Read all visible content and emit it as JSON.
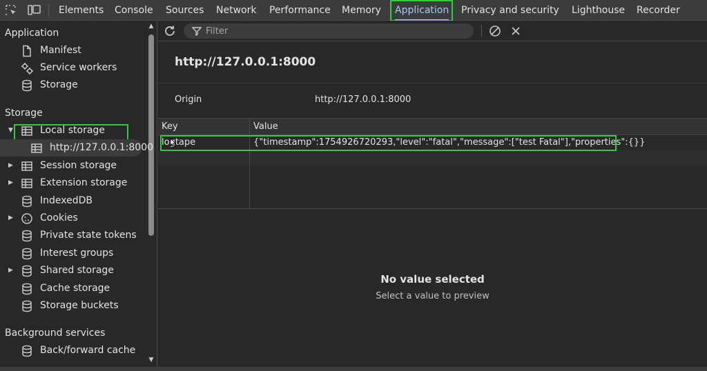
{
  "tabs": [
    {
      "label": "Elements"
    },
    {
      "label": "Console"
    },
    {
      "label": "Sources"
    },
    {
      "label": "Network"
    },
    {
      "label": "Performance"
    },
    {
      "label": "Memory"
    },
    {
      "label": "Application",
      "active": true
    },
    {
      "label": "Privacy and security"
    },
    {
      "label": "Lighthouse"
    },
    {
      "label": "Recorder"
    }
  ],
  "sidebar": {
    "application": {
      "title": "Application",
      "items": [
        {
          "label": "Manifest",
          "icon": "document-icon"
        },
        {
          "label": "Service workers",
          "icon": "gears-icon"
        },
        {
          "label": "Storage",
          "icon": "database-icon"
        }
      ]
    },
    "storage": {
      "title": "Storage",
      "items": [
        {
          "label": "Local storage",
          "icon": "table-icon",
          "expanded": true
        },
        {
          "label": "http://127.0.0.1:8000",
          "icon": "table-icon",
          "selected": true
        },
        {
          "label": "Session storage",
          "icon": "table-icon"
        },
        {
          "label": "Extension storage",
          "icon": "table-icon"
        },
        {
          "label": "IndexedDB",
          "icon": "database-icon"
        },
        {
          "label": "Cookies",
          "icon": "cookie-icon"
        },
        {
          "label": "Private state tokens",
          "icon": "database-icon"
        },
        {
          "label": "Interest groups",
          "icon": "database-icon"
        },
        {
          "label": "Shared storage",
          "icon": "database-icon"
        },
        {
          "label": "Cache storage",
          "icon": "database-icon"
        },
        {
          "label": "Storage buckets",
          "icon": "database-icon"
        }
      ]
    },
    "background": {
      "title": "Background services",
      "items": [
        {
          "label": "Back/forward cache",
          "icon": "database-icon"
        }
      ]
    }
  },
  "toolbar": {
    "filter_placeholder": "Filter"
  },
  "origin_panel": {
    "title": "http://127.0.0.1:8000",
    "origin_label": "Origin",
    "origin_value": "http://127.0.0.1:8000"
  },
  "table": {
    "columns": [
      "Key",
      "Value"
    ],
    "rows": [
      {
        "key": "logtape",
        "value": "{\"timestamp\":1754926720293,\"level\":\"fatal\",\"message\":[\"test Fatal\"],\"properties\":{}}"
      }
    ]
  },
  "preview": {
    "title": "No value selected",
    "subtitle": "Select a value to preview"
  },
  "colors": {
    "accent": "#a8c7fa",
    "highlight": "#2ecc40",
    "background": "#282828"
  }
}
